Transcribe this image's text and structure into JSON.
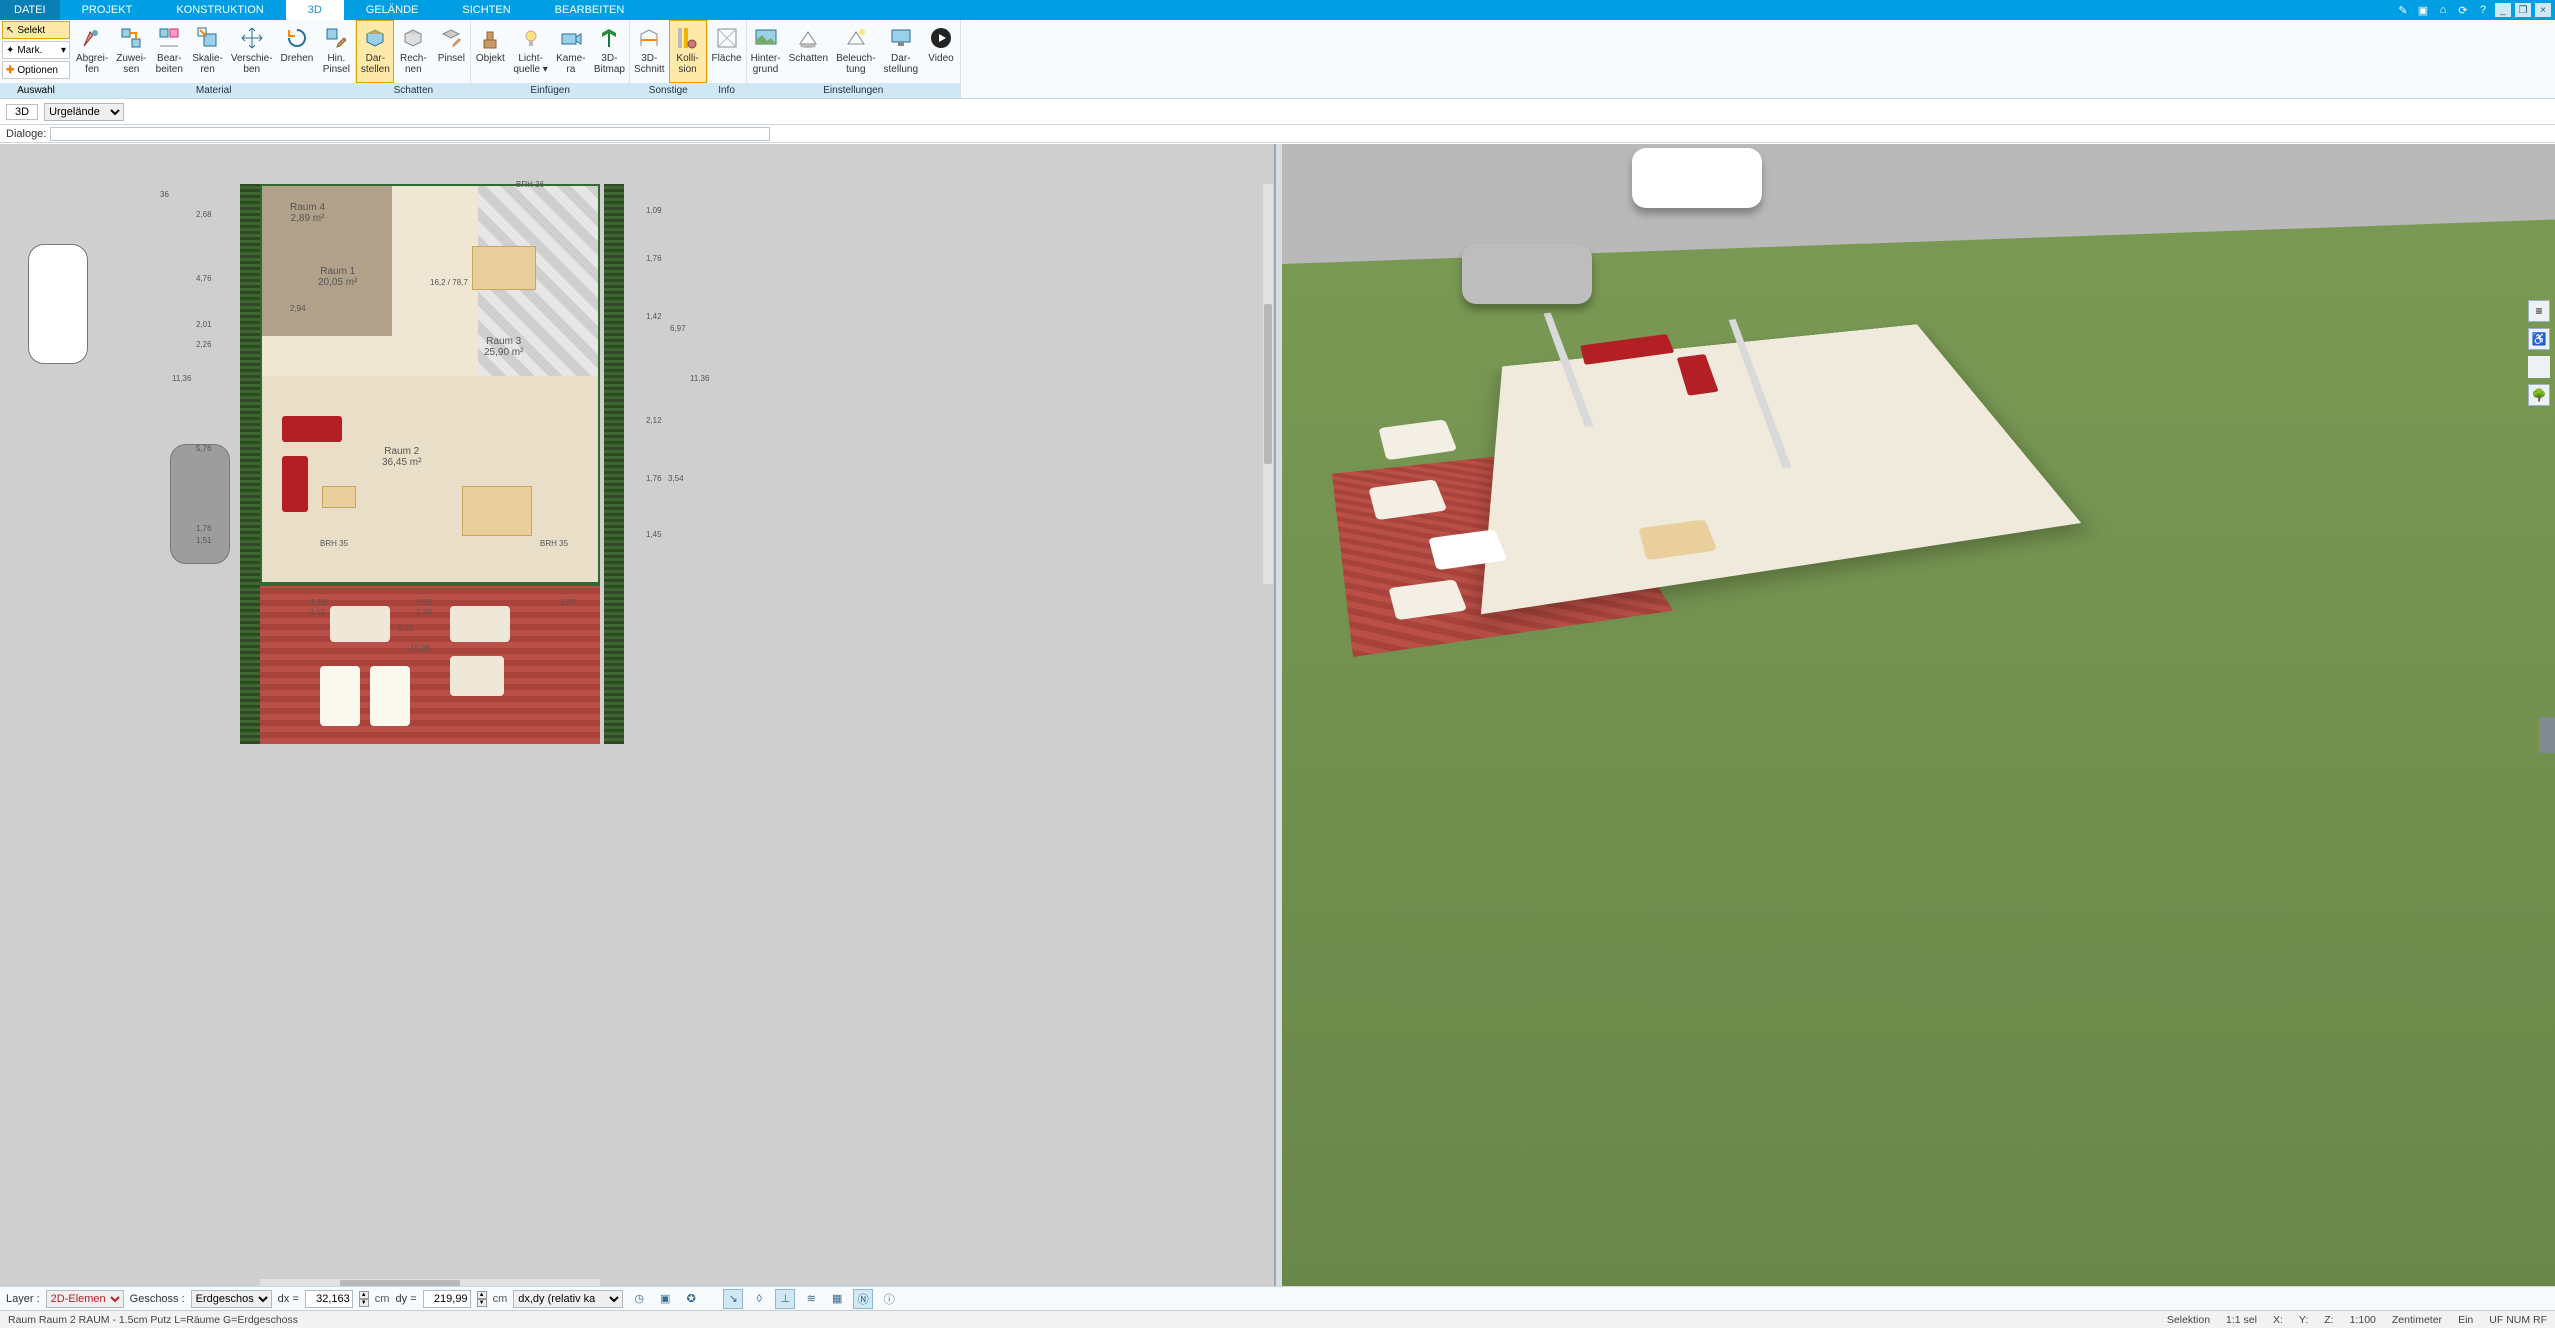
{
  "menu": {
    "file": "DATEI",
    "items": [
      "PROJEKT",
      "KONSTRUKTION",
      "3D",
      "GELÄNDE",
      "SICHTEN",
      "BEARBEITEN"
    ],
    "active_index": 2
  },
  "leftpanel": {
    "select": "Selekt",
    "mark": "Mark.",
    "optionen": "Optionen",
    "foot": "Auswahl"
  },
  "ribbon": {
    "groups": [
      {
        "foot": "Material",
        "buttons": [
          {
            "id": "abgreifen",
            "l1": "Abgrei-",
            "l2": "fen"
          },
          {
            "id": "zuweisen",
            "l1": "Zuwei-",
            "l2": "sen"
          },
          {
            "id": "bearbeiten",
            "l1": "Bear-",
            "l2": "beiten"
          },
          {
            "id": "skalieren",
            "l1": "Skalie-",
            "l2": "ren"
          },
          {
            "id": "verschieben",
            "l1": "Verschie-",
            "l2": "ben"
          },
          {
            "id": "drehen",
            "l1": "Drehen",
            "l2": ""
          },
          {
            "id": "hinpinsel",
            "l1": "Hin.",
            "l2": "Pinsel"
          }
        ]
      },
      {
        "foot": "Schatten",
        "buttons": [
          {
            "id": "darstellen",
            "l1": "Dar-",
            "l2": "stellen",
            "active": true
          },
          {
            "id": "rechnen",
            "l1": "Rech-",
            "l2": "nen"
          },
          {
            "id": "pinsel",
            "l1": "Pinsel",
            "l2": ""
          }
        ]
      },
      {
        "foot": "Einfügen",
        "buttons": [
          {
            "id": "objekt",
            "l1": "Objekt",
            "l2": ""
          },
          {
            "id": "lichtquelle",
            "l1": "Licht-",
            "l2": "quelle ▾"
          },
          {
            "id": "kamera",
            "l1": "Kame-",
            "l2": "ra"
          },
          {
            "id": "bitmap3d",
            "l1": "3D-",
            "l2": "Bitmap"
          }
        ]
      },
      {
        "foot": "Sonstige",
        "buttons": [
          {
            "id": "schnitt3d",
            "l1": "3D-",
            "l2": "Schnitt"
          },
          {
            "id": "kollision",
            "l1": "Kolli-",
            "l2": "sion",
            "active": true
          }
        ]
      },
      {
        "foot": "Info",
        "buttons": [
          {
            "id": "flaeche",
            "l1": "Fläche",
            "l2": ""
          }
        ]
      },
      {
        "foot": "Einstellungen",
        "buttons": [
          {
            "id": "hintergrund",
            "l1": "Hinter-",
            "l2": "grund"
          },
          {
            "id": "schatten",
            "l1": "Schatten",
            "l2": ""
          },
          {
            "id": "beleuchtung",
            "l1": "Beleuch-",
            "l2": "tung"
          },
          {
            "id": "darstellung",
            "l1": "Dar-",
            "l2": "stellung"
          },
          {
            "id": "video",
            "l1": "Video",
            "l2": ""
          }
        ]
      }
    ]
  },
  "context": {
    "mode": "3D",
    "layer": "Urgelände"
  },
  "dialoge_label": "Dialoge:",
  "rooms": {
    "r1": "Raum 1\n20,05 m²",
    "r2": "Raum 2\n36,45 m²",
    "r3": "Raum 3\n25,90 m²",
    "r4": "Raum 4\n2,89 m²"
  },
  "dims": {
    "a": "1,76",
    "b": "1,51",
    "c": "1,09",
    "d": "6,97",
    "e": "11,36",
    "f": "2,12",
    "g": "3,54",
    "h": "1,45",
    "i": "1,42",
    "j": "2,68",
    "k": "4,76",
    "l": "2,01",
    "m": "2,26",
    "n": "5,76",
    "o": "2,94",
    "p": "16,2 / 78,7",
    "q": "10,36",
    "r": "9,61",
    "s": "2,02",
    "t": "2,20",
    "u": "1,37",
    "brh": "BRH 35",
    "brh2": "BRH 36",
    "tag36": "36"
  },
  "bottom": {
    "layer_lbl": "Layer :",
    "layer_val": "2D-Elemen",
    "geschoss_lbl": "Geschoss :",
    "geschoss_val": "Erdgeschos",
    "dx_lbl": "dx =",
    "dx_val": "32,163",
    "dy_lbl": "dy =",
    "dy_val": "219,99",
    "unit": "cm",
    "mode": "dx,dy (relativ ka"
  },
  "status": {
    "info": "Raum Raum 2 RAUM - 1.5cm Putz L=Räume G=Erdgeschoss",
    "sel": "Selektion",
    "ratio": "1:1 sel",
    "x": "X:",
    "y": "Y:",
    "z": "Z:",
    "scale": "1:100",
    "unit": "Zentimeter",
    "ein": "Ein",
    "ufnum": "UF NUM RF"
  }
}
